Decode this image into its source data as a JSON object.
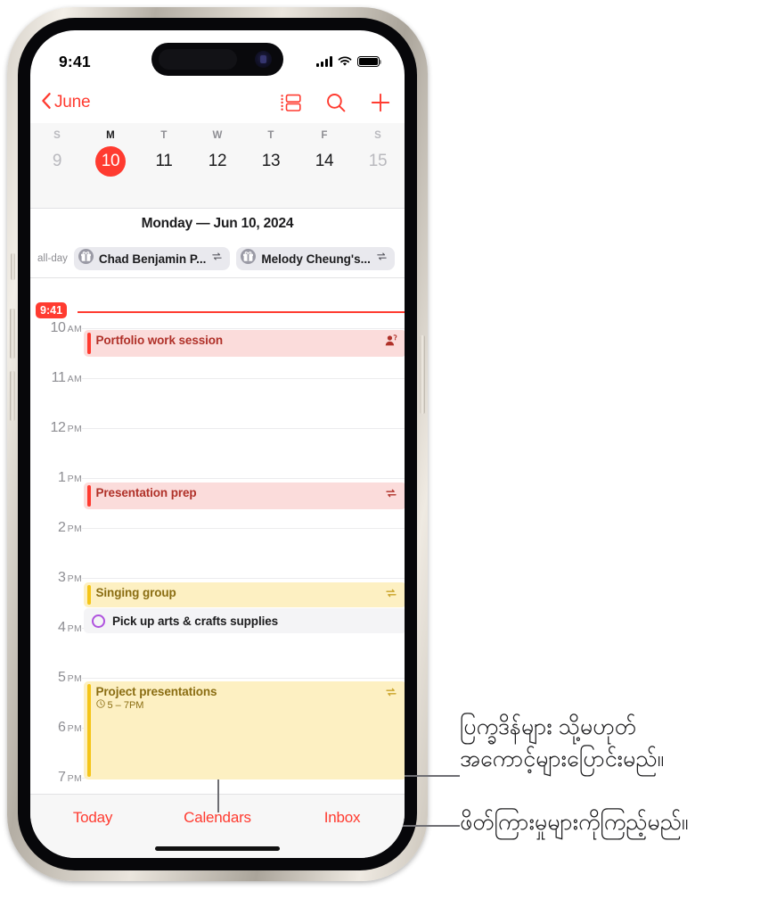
{
  "status_bar": {
    "time": "9:41",
    "cellular_icon": "cellular-bars-icon",
    "wifi_icon": "wifi-icon",
    "battery_icon": "battery-full-icon"
  },
  "nav_bar": {
    "back_label": "June",
    "back_icon": "chevron-left-icon",
    "actions": [
      {
        "name": "list-view-icon",
        "label": "List view"
      },
      {
        "name": "search-icon",
        "label": "Search"
      },
      {
        "name": "plus-icon",
        "label": "Add event"
      }
    ]
  },
  "week_strip": {
    "days": [
      {
        "dow": "S",
        "num": "9",
        "weekend": true,
        "today": false
      },
      {
        "dow": "M",
        "num": "10",
        "weekend": false,
        "today": true
      },
      {
        "dow": "T",
        "num": "11",
        "weekend": false,
        "today": false
      },
      {
        "dow": "W",
        "num": "12",
        "weekend": false,
        "today": false
      },
      {
        "dow": "T",
        "num": "13",
        "weekend": false,
        "today": false
      },
      {
        "dow": "F",
        "num": "14",
        "weekend": false,
        "today": false
      },
      {
        "dow": "S",
        "num": "15",
        "weekend": true,
        "today": false
      }
    ],
    "today_accent": "#ff3b30"
  },
  "day_header": {
    "title": "Monday — Jun 10, 2024"
  },
  "all_day": {
    "label": "all-day",
    "events": [
      {
        "title": "Chad Benjamin P...",
        "icon": "gift-icon",
        "badge": "repeat-icon"
      },
      {
        "title": "Melody Cheung's...",
        "icon": "gift-icon",
        "badge": "repeat-icon"
      }
    ]
  },
  "timeline": {
    "now": {
      "time": "9:41",
      "color": "#ff3b30"
    },
    "hours": [
      {
        "hour": "10",
        "meridiem": "AM"
      },
      {
        "hour": "11",
        "meridiem": "AM"
      },
      {
        "hour": "12",
        "meridiem": "PM"
      },
      {
        "hour": "1",
        "meridiem": "PM"
      },
      {
        "hour": "2",
        "meridiem": "PM"
      },
      {
        "hour": "3",
        "meridiem": "PM"
      },
      {
        "hour": "4",
        "meridiem": "PM"
      },
      {
        "hour": "5",
        "meridiem": "PM"
      },
      {
        "hour": "6",
        "meridiem": "PM"
      },
      {
        "hour": "7",
        "meridiem": "PM"
      }
    ],
    "events": [
      {
        "title": "Portfolio work session",
        "time": "",
        "color": "red",
        "badge": "person-invite-icon"
      },
      {
        "title": "Presentation prep",
        "time": "",
        "color": "red",
        "badge": "repeat-icon"
      },
      {
        "title": "Singing group",
        "time": "",
        "color": "yellow",
        "badge": "repeat-icon"
      },
      {
        "title": "Project presentations",
        "time": "5 – 7PM",
        "time_icon": "clock-icon",
        "color": "yellow",
        "badge": "repeat-icon"
      }
    ],
    "reminders": [
      {
        "title": "Pick up arts & crafts supplies",
        "circle_color": "#af52de"
      }
    ]
  },
  "tab_bar": {
    "tabs": [
      {
        "label": "Today"
      },
      {
        "label": "Calendars"
      },
      {
        "label": "Inbox"
      }
    ],
    "accent": "#ff3b30"
  },
  "callouts": [
    {
      "line1": "ပြက္ခဒိန်များ သို့မဟုတ်",
      "line2": "အကောင့်များပြောင်းမည်။"
    },
    {
      "line1": "ဖိတ်ကြားမှုများကိုကြည့်မည်။",
      "line2": ""
    }
  ]
}
